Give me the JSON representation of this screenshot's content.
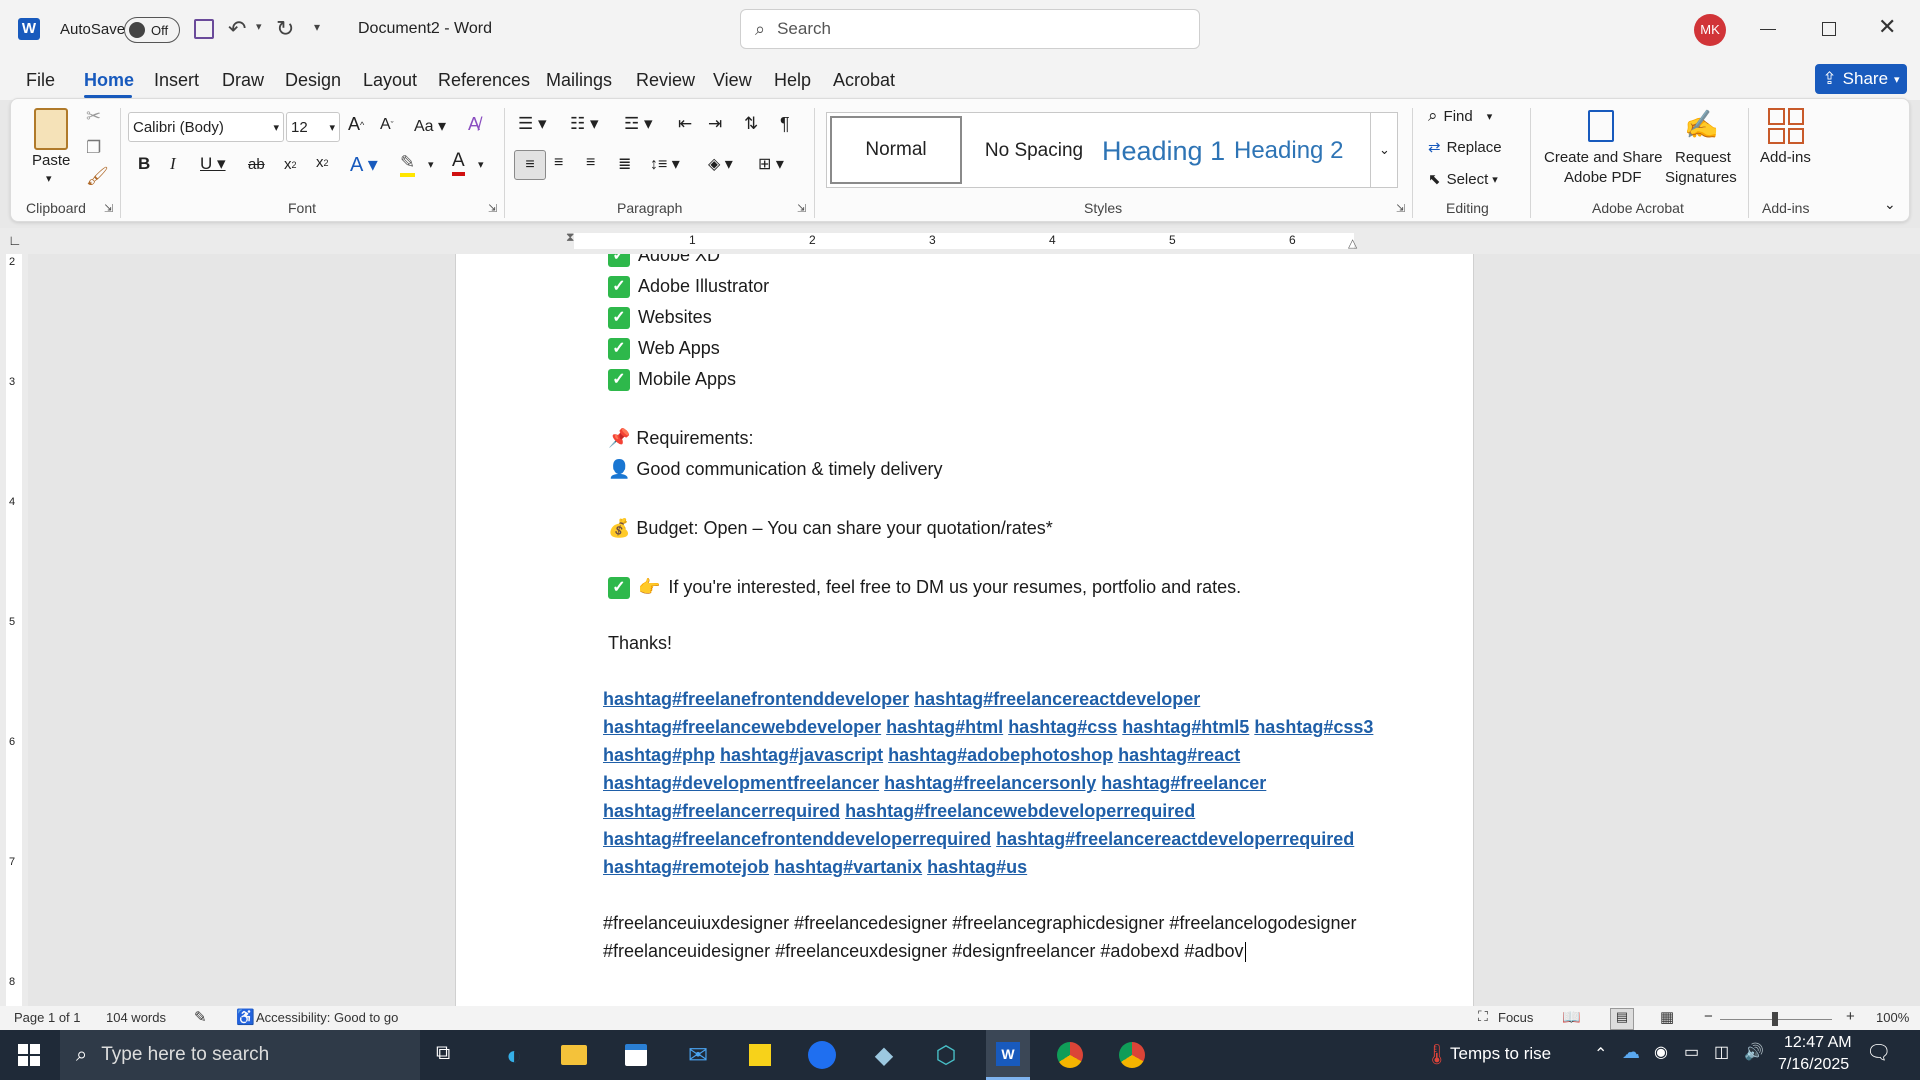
{
  "titlebar": {
    "autosave_label": "AutoSave",
    "autosave_state": "Off",
    "doc_title": "Document2 - Word",
    "search_placeholder": "Search",
    "user_initials": "MK",
    "accent": "#185abd"
  },
  "tabs": [
    "File",
    "Home",
    "Insert",
    "Draw",
    "Design",
    "Layout",
    "References",
    "Mailings",
    "Review",
    "View",
    "Help",
    "Acrobat"
  ],
  "share_label": "Share",
  "ribbon": {
    "clipboard": {
      "paste": "Paste",
      "label": "Clipboard"
    },
    "font": {
      "family": "Calibri (Body)",
      "size": "12",
      "label": "Font"
    },
    "paragraph": {
      "label": "Paragraph"
    },
    "styles": {
      "normal": "Normal",
      "nospacing": "No Spacing",
      "heading1": "Heading 1",
      "heading2": "Heading 2",
      "label": "Styles"
    },
    "editing": {
      "find": "Find",
      "replace": "Replace",
      "select": "Select",
      "label": "Editing"
    },
    "acrobat": {
      "create": "Create and Share",
      "create2": "Adobe PDF",
      "request": "Request",
      "request2": "Signatures",
      "label": "Adobe Acrobat"
    },
    "addins": {
      "btn": "Add-ins",
      "label": "Add-ins"
    }
  },
  "ruler": {
    "h_ticks": [
      "1",
      "2",
      "3",
      "4",
      "5",
      "6"
    ],
    "v_ticks": [
      "2",
      "3",
      "4",
      "5",
      "6",
      "7",
      "8"
    ]
  },
  "document": {
    "list_items": [
      "Adobe XD",
      "Adobe Illustrator",
      "Websites",
      "Web Apps",
      "Mobile Apps"
    ],
    "requirements_title": "Requirements:",
    "requirement": "Good communication & timely delivery",
    "budget": "Budget: Open – You can share your quotation/rates*",
    "interested": "If you're interested, feel free to DM us your resumes, portfolio and rates.",
    "thanks": "Thanks!",
    "hashtag_lines": [
      [
        "hashtag#freelanefrontenddeveloper",
        "hashtag#freelancereactdeveloper"
      ],
      [
        "hashtag#freelancewebdeveloper",
        "hashtag#html",
        "hashtag#css",
        "hashtag#html5",
        "hashtag#css3"
      ],
      [
        "hashtag#php",
        "hashtag#javascript",
        "hashtag#adobephotoshop",
        "hashtag#react"
      ],
      [
        "hashtag#developmentfreelancer",
        "hashtag#freelancersonly",
        "hashtag#freelancer"
      ],
      [
        "hashtag#freelancerrequired",
        "hashtag#freelancewebdeveloperrequired"
      ],
      [
        "hashtag#freelancefrontenddeveloperrequired",
        "hashtag#freelancereactdeveloperrequired"
      ],
      [
        "hashtag#remotejob",
        "hashtag#vartanix",
        "hashtag#us"
      ]
    ],
    "plain_line1": "#freelanceuiuxdesigner #freelancedesigner #freelancegraphicdesigner #freelancelogodesigner",
    "plain_line2": "#freelanceuidesigner #freelanceuxdesigner #designfreelancer #adobexd #adbov"
  },
  "status": {
    "page": "Page 1 of 1",
    "words": "104 words",
    "accessibility": "Accessibility: Good to go",
    "focus": "Focus",
    "zoom": "100%"
  },
  "taskbar": {
    "search_placeholder": "Type here to search",
    "weather": "Temps to rise",
    "time": "12:47 AM",
    "date": "7/16/2025"
  }
}
